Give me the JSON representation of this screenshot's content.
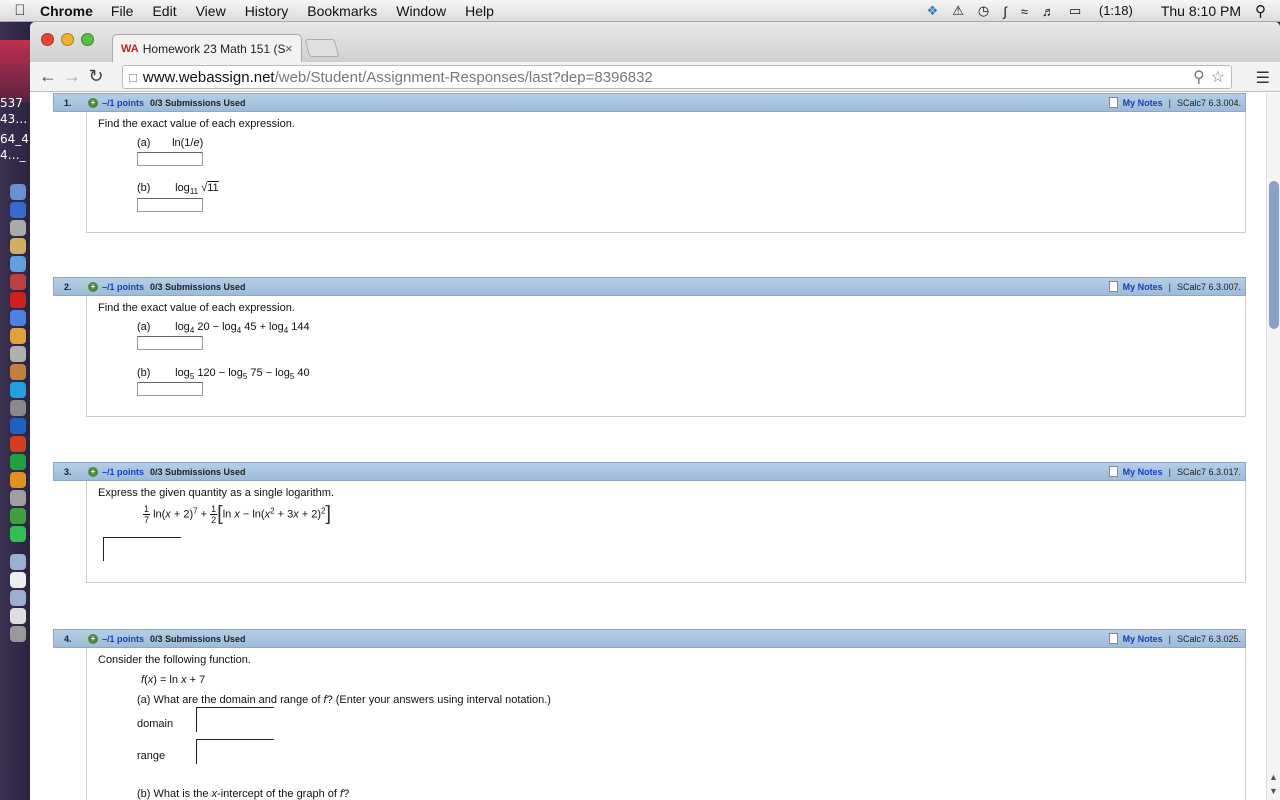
{
  "menubar": {
    "app": "Chrome",
    "menus": [
      "File",
      "Edit",
      "View",
      "History",
      "Bookmarks",
      "Window",
      "Help"
    ],
    "battery": "(1:18)",
    "clock": "Thu 8:10 PM"
  },
  "dock": {
    "lines": [
      "537",
      "43…",
      "64_4",
      "4…_"
    ]
  },
  "browser": {
    "tab_title": "Homework 23 Math 151 (S",
    "tab_favicon": "WA",
    "url_host": "www.webassign.net",
    "url_path": "/web/Student/Assignment-Responses/last?dep=8396832"
  },
  "questions": [
    {
      "number": "1.",
      "points": "–/1 points",
      "submissions": "0/3 Submissions Used",
      "notes": "My Notes",
      "separator": "|",
      "source": "SCalc7 6.3.004.",
      "prompt": "Find the exact value of each expression.",
      "parts": [
        {
          "label": "(a)",
          "expr": "ln(1/e)"
        },
        {
          "label": "(b)",
          "expr": "log11 √11"
        }
      ]
    },
    {
      "number": "2.",
      "points": "–/1 points",
      "submissions": "0/3 Submissions Used",
      "notes": "My Notes",
      "separator": "|",
      "source": "SCalc7 6.3.007.",
      "prompt": "Find the exact value of each expression.",
      "parts": [
        {
          "label": "(a)",
          "expr": "log4 20 − log4 45 + log4 144"
        },
        {
          "label": "(b)",
          "expr": "log5 120 − log5 75 − log5 40"
        }
      ]
    },
    {
      "number": "3.",
      "points": "–/1 points",
      "submissions": "0/3 Submissions Used",
      "notes": "My Notes",
      "separator": "|",
      "source": "SCalc7 6.3.017.",
      "prompt": "Express the given quantity as a single logarithm."
    },
    {
      "number": "4.",
      "points": "–/1 points",
      "submissions": "0/3 Submissions Used",
      "notes": "My Notes",
      "separator": "|",
      "source": "SCalc7 6.3.025.",
      "prompt": "Consider the following function.",
      "function": "f(x) = ln x + 7",
      "part_a": "(a) What are the domain and range of f? (Enter your answers using interval notation.)",
      "domain_label": "domain",
      "range_label": "range",
      "part_b": "(b) What is the x-intercept of the graph of f?"
    }
  ],
  "colors": {
    "header_bg": "#a9c5e0",
    "link_blue": "#1a3ec0"
  }
}
